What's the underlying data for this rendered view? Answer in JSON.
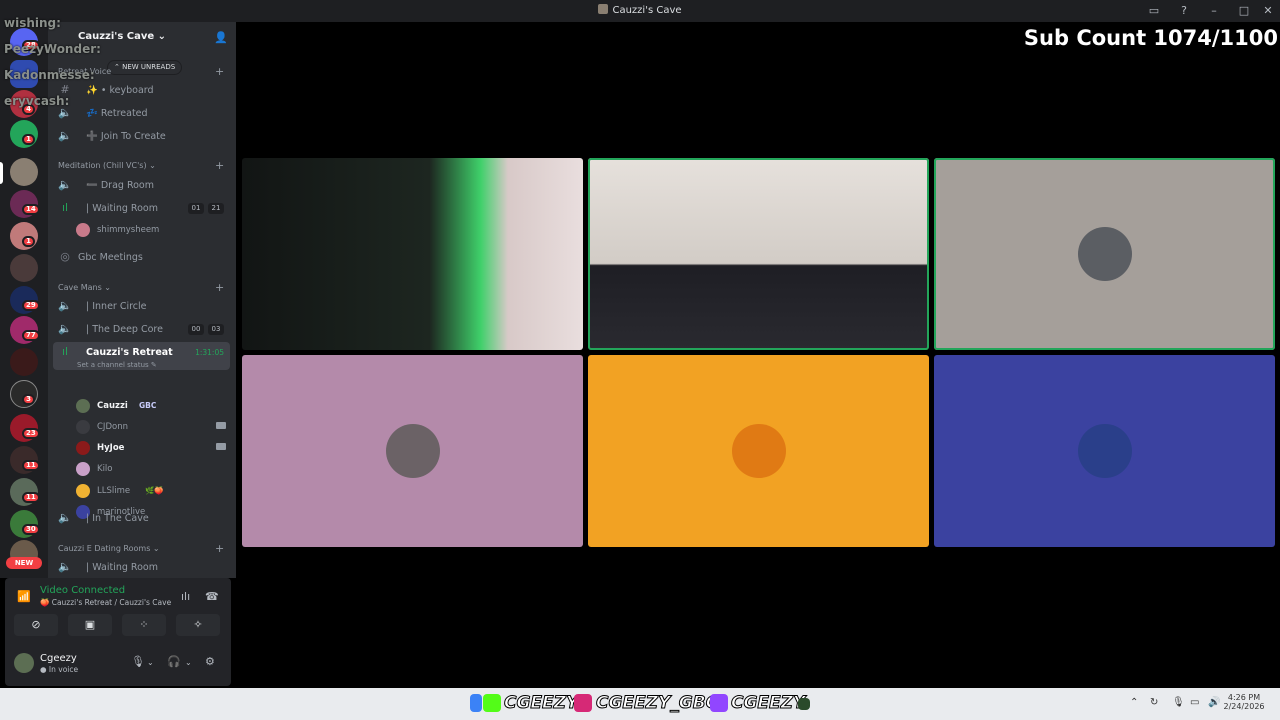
{
  "window": {
    "title": "Cauzzi's Cave"
  },
  "overlay": {
    "lines": [
      "wishing:",
      "PeezyWonder:",
      "Kadonmesse:",
      "eryvcash:"
    ]
  },
  "guild_badges": [
    "28",
    "4",
    "1",
    "14",
    "1",
    "29",
    "77",
    "3",
    "23",
    "11",
    "11",
    "30"
  ],
  "guild_new": "NEW",
  "server": {
    "name": "Cauzzi's Cave ⌄",
    "new_unreads": "⌃ NEW UNREADS"
  },
  "categories": [
    {
      "label": "Retreat Voice",
      "items": [
        "keyboard",
        "Retreated",
        "Join To Create"
      ]
    },
    {
      "label": "Meditation (Chill VC's) ⌄"
    },
    {
      "label": "Cave Mans ⌄"
    },
    {
      "label": "Cauzzi E Dating Rooms ⌄"
    }
  ],
  "channels": {
    "keyboard": "✨ • keyboard",
    "retreated": "💤 Retreated",
    "join": "➕ Join To Create",
    "drag_room": "➖ Drag Room",
    "waiting_room": "| Waiting Room",
    "waiting_counts": [
      "01",
      "21"
    ],
    "shimmysheem": "shimmysheem",
    "gbc_meetings": "Gbc Meetings",
    "inner_circle": "| Inner Circle",
    "deep_core": "| The Deep Core",
    "deep_counts": [
      "00",
      "03"
    ],
    "retreat": "Cauzzi's Retreat",
    "retreat_timer": "1:31:05",
    "set_status": "Set a channel status ✎",
    "in_the_cave": "| In The Cave",
    "waiting_room2": "| Waiting Room"
  },
  "voice_users": [
    {
      "name": "Cauzzi",
      "tag": "GBC",
      "bold": true,
      "cam": false,
      "color": "#5c6e53"
    },
    {
      "name": "CJDonn",
      "tag": "",
      "bold": false,
      "cam": true,
      "color": "#3a3b40"
    },
    {
      "name": "HyJoe",
      "tag": "",
      "bold": true,
      "cam": true,
      "color": "#8b1a1a"
    },
    {
      "name": "Kilo",
      "tag": "",
      "bold": false,
      "cam": false,
      "color": "#c9a0c8"
    },
    {
      "name": "LLSlime",
      "tag": "🌿🍑",
      "bold": false,
      "cam": false,
      "color": "#f0b232"
    },
    {
      "name": "marinotlive",
      "tag": "",
      "bold": false,
      "cam": false,
      "color": "#3b42a0"
    }
  ],
  "voice_panel": {
    "title": "Video Connected",
    "subtitle": "🍑 Cauzzi's Retreat / Cauzzi's Cave"
  },
  "user_panel": {
    "name": "Cgeezy",
    "status": "● In voice"
  },
  "stream": {
    "sub_count": "Sub Count 1074/1100"
  },
  "tiles": [
    {
      "bg": "#2b3a2d",
      "speaking": false
    },
    {
      "bg": "#d9d4cf",
      "speaking": true
    },
    {
      "bg": "#a59f9a",
      "speaking": true,
      "avatar": "#5b5e63"
    },
    {
      "bg": "#b48aaa",
      "speaking": false,
      "avatar": "#6b6266"
    },
    {
      "bg": "#f2a223",
      "speaking": false,
      "avatar": "#e07a14"
    },
    {
      "bg": "#3b42a0",
      "speaking": false,
      "avatar": "#2a3f8a"
    }
  ],
  "taskbar": {
    "social1": "CGEEZY",
    "social2": "CGEEZY_GBC",
    "social3": "CGEEZY",
    "time": "4:26 PM",
    "date": "2/24/2026"
  }
}
